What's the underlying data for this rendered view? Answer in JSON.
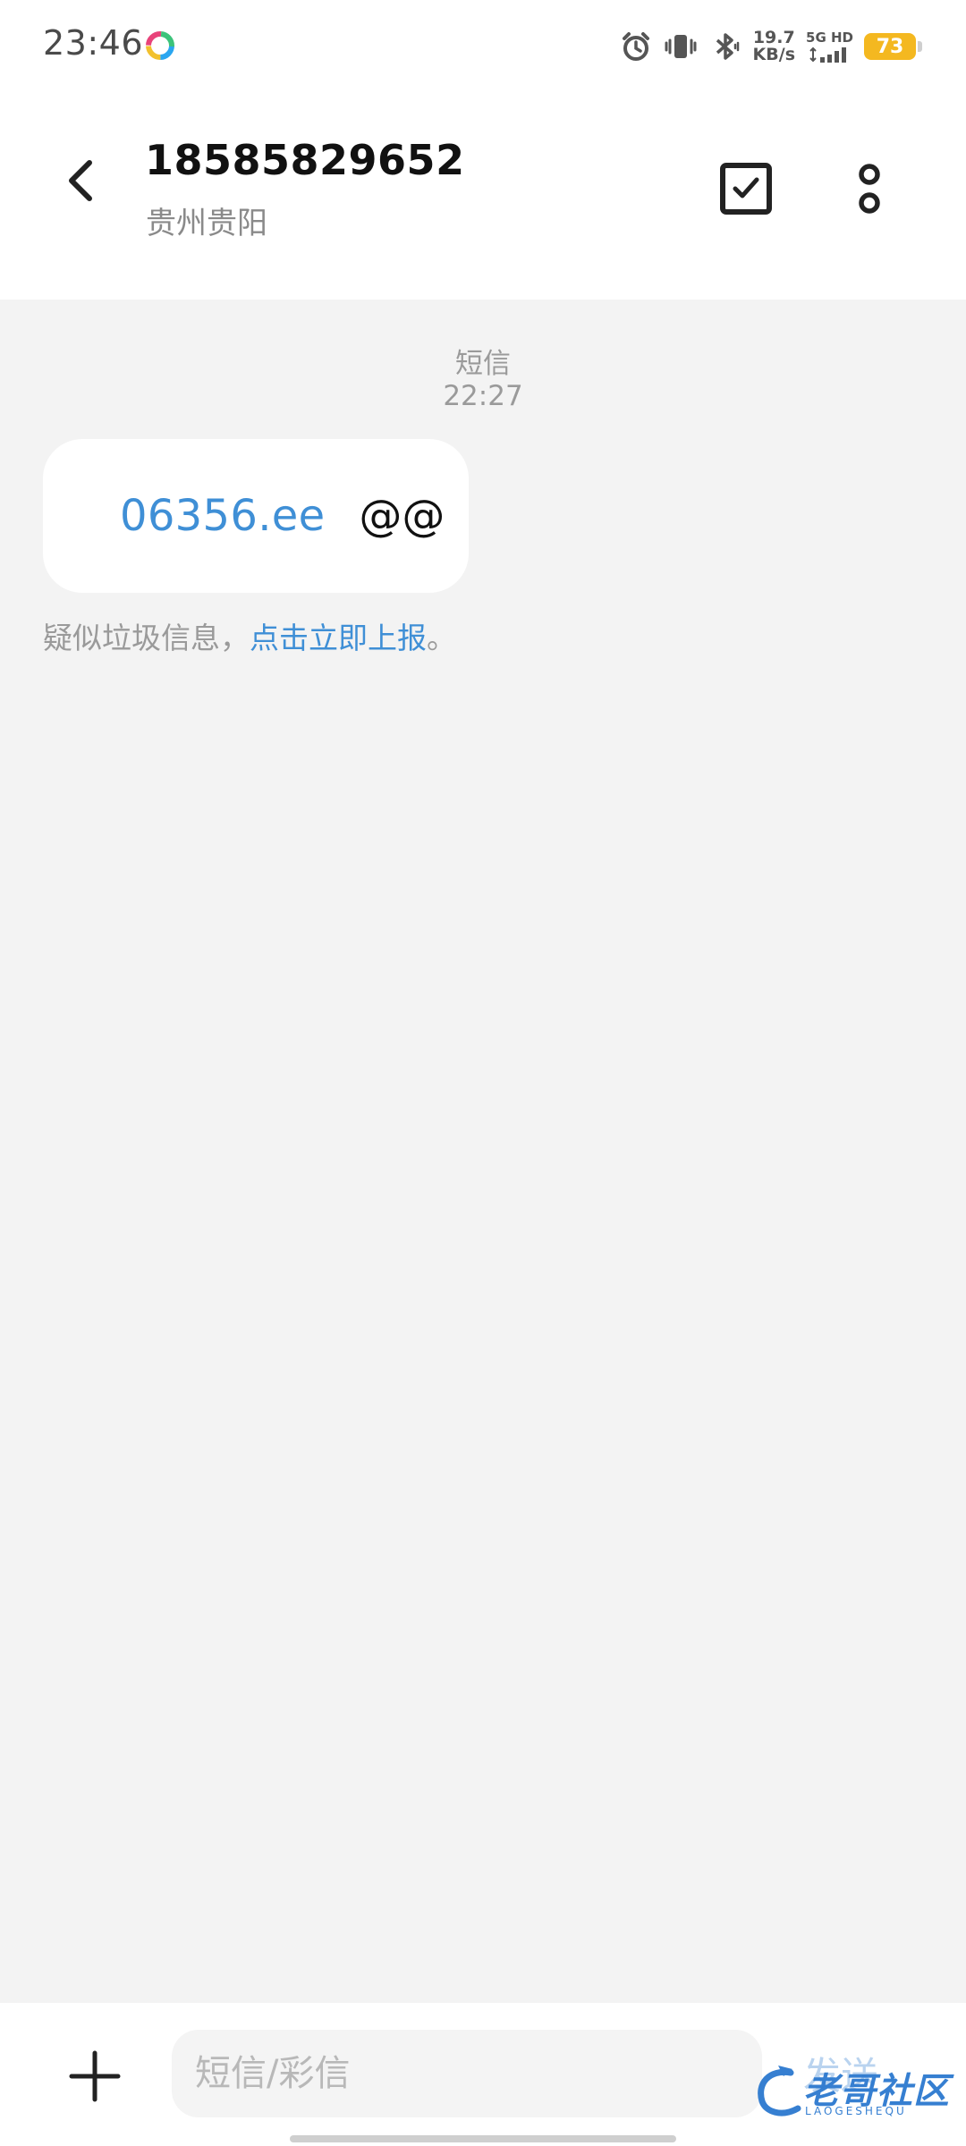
{
  "status_bar": {
    "time": "23:46",
    "net_speed_value": "19.7",
    "net_speed_unit": "KB/s",
    "network_type": "5G HD",
    "battery_level": "73",
    "colors": {
      "battery": "#f4b820"
    },
    "icons": [
      "app-notification-icon",
      "alarm-icon",
      "vibrate-icon",
      "bluetooth-icon",
      "signal-icon",
      "battery-icon"
    ]
  },
  "header": {
    "contact_number": "18585829652",
    "contact_location": "贵州贵阳",
    "icons": [
      "back-arrow-icon",
      "select-checkbox-icon",
      "more-options-icon"
    ]
  },
  "conversation": {
    "message_type": "短信",
    "message_time": "22:27",
    "message": {
      "link_text": "06356.ee",
      "text": "@@"
    },
    "spam_notice": {
      "prefix": "疑似垃圾信息，",
      "link": "点击立即上报",
      "suffix": "。"
    },
    "colors": {
      "link": "#3f8fd6",
      "background": "#f3f3f3"
    }
  },
  "input_bar": {
    "placeholder": "短信/彩信",
    "send_label": "发送",
    "watermark_text": "老哥社区",
    "watermark_sub": "LAOGESHEQU",
    "icons": [
      "plus-icon"
    ]
  }
}
